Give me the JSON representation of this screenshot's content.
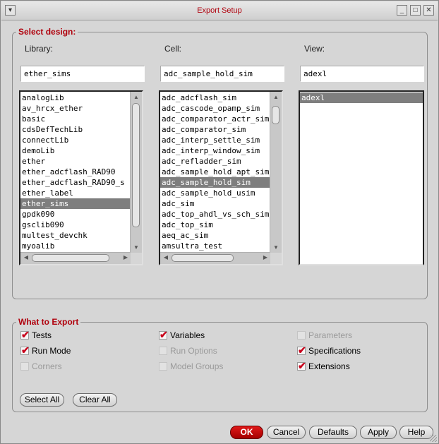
{
  "window": {
    "title": "Export Setup"
  },
  "select_design": {
    "title": "Select design:",
    "library": {
      "label": "Library:",
      "value": "ether_sims",
      "items": [
        "analogLib",
        "av_hrcx_ether",
        "basic",
        "cdsDefTechLib",
        "connectLib",
        "demoLib",
        "ether",
        "ether_adcflash_RAD90",
        "ether_adcflash_RAD90_s",
        "ether_label",
        "ether_sims",
        "gpdk090",
        "gsclib090",
        "multest_devchk",
        "myoalib"
      ],
      "selected": "ether_sims"
    },
    "cell": {
      "label": "Cell:",
      "value": "adc_sample_hold_sim",
      "items": [
        "adc_adcflash_sim",
        "adc_cascode_opamp_sim",
        "adc_comparator_actr_sim",
        "adc_comparator_sim",
        "adc_interp_settle_sim",
        "adc_interp_window_sim",
        "adc_refladder_sim",
        "adc_sample_hold_apt_sim",
        "adc_sample_hold_sim",
        "adc_sample_hold_usim",
        "adc_sim",
        "adc_top_ahdl_vs_sch_sim",
        "adc_top_sim",
        "aeq_ac_sim",
        "amsultra_test"
      ],
      "selected": "adc_sample_hold_sim"
    },
    "view": {
      "label": "View:",
      "value": "adexl",
      "items": [
        "adexl"
      ],
      "selected": "adexl"
    }
  },
  "what_to_export": {
    "title": "What to Export",
    "options": [
      {
        "label": "Tests",
        "checked": true,
        "enabled": true
      },
      {
        "label": "Variables",
        "checked": true,
        "enabled": true
      },
      {
        "label": "Parameters",
        "checked": false,
        "enabled": false
      },
      {
        "label": "Run Mode",
        "checked": true,
        "enabled": true
      },
      {
        "label": "Run Options",
        "checked": false,
        "enabled": false
      },
      {
        "label": "Specifications",
        "checked": true,
        "enabled": true
      },
      {
        "label": "Corners",
        "checked": false,
        "enabled": false
      },
      {
        "label": "Model Groups",
        "checked": false,
        "enabled": false
      },
      {
        "label": "Extensions",
        "checked": true,
        "enabled": true
      }
    ],
    "select_all": "Select All",
    "clear_all": "Clear All"
  },
  "buttons": {
    "ok": "OK",
    "cancel": "Cancel",
    "defaults": "Defaults",
    "apply": "Apply",
    "help": "Help"
  },
  "colors": {
    "accent": "#b0000c",
    "ok_button": "#c8001a",
    "selection": "#7e7e7e"
  }
}
